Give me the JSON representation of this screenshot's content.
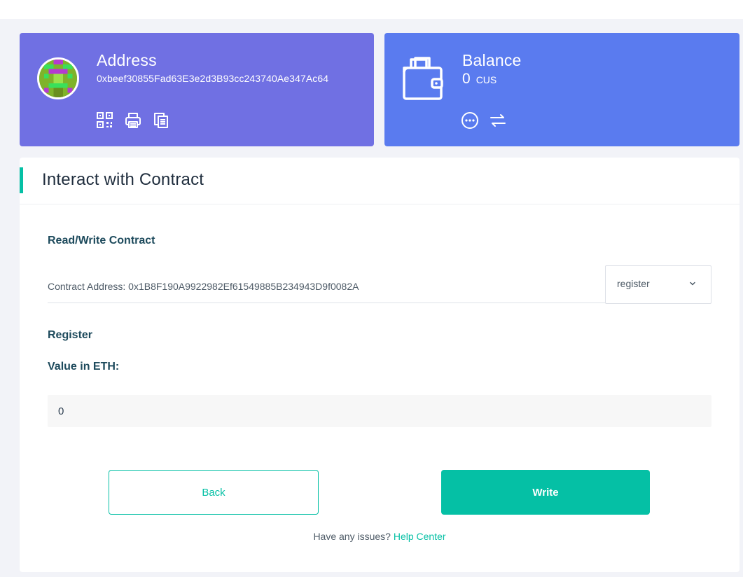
{
  "address_card": {
    "title": "Address",
    "value": "0xbeef30855Fad63E3e2d3B93cc243740Ae347Ac64",
    "icons": [
      "qrcode-icon",
      "print-icon",
      "copy-icon"
    ],
    "bg_color": "#7070e3"
  },
  "balance_card": {
    "title": "Balance",
    "amount": "0",
    "unit": "CUS",
    "icons": [
      "wallet-icon",
      "more-icon",
      "swap-icon"
    ],
    "bg_color": "#5a7bef"
  },
  "panel": {
    "title": "Interact with Contract",
    "read_write_label": "Read/Write Contract",
    "contract_address": "Contract Address: 0x1B8F190A9922982Ef61549885B234943D9f0082A",
    "function_select": {
      "selected": "register",
      "icon": "chevron-down-icon"
    },
    "function_name": "Register",
    "value_label": "Value in ETH:",
    "value_input": "0",
    "back_label": "Back",
    "write_label": "Write",
    "help_text": "Have any issues?",
    "help_link": "Help Center"
  },
  "colors": {
    "accent": "#05c0a5",
    "page_bg": "#f2f3f8",
    "label_text": "#1d4a5c"
  }
}
